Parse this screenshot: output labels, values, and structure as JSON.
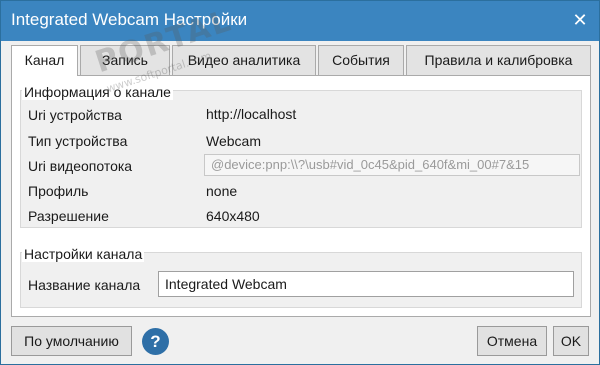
{
  "window": {
    "title": "Integrated Webcam Настройки",
    "close_icon": "close-icon"
  },
  "tabs": [
    {
      "label": "Канал",
      "active": true
    },
    {
      "label": "Запись",
      "active": false
    },
    {
      "label": "Видео аналитика",
      "active": false
    },
    {
      "label": "События",
      "active": false
    },
    {
      "label": "Правила и калибровка",
      "active": false
    }
  ],
  "channel_info": {
    "legend": "Информация о канале",
    "rows": [
      {
        "label": "Uri устройства",
        "value": "http://localhost"
      },
      {
        "label": "Тип устройства",
        "value": "Webcam"
      },
      {
        "label": "Uri видеопотока",
        "value": "@device:pnp:\\\\?\\usb#vid_0c45&pid_640f&mi_00#7&15"
      },
      {
        "label": "Профиль",
        "value": "none"
      },
      {
        "label": "Разрешение",
        "value": "640x480"
      }
    ]
  },
  "channel_settings": {
    "legend": "Настройки канала",
    "name_label": "Название канала",
    "name_value": "Integrated Webcam"
  },
  "footer": {
    "default_label": "По умолчанию",
    "help_icon": "help-icon",
    "help_glyph": "?",
    "cancel_label": "Отмена",
    "ok_label": "OK"
  },
  "watermark": {
    "text": "PORTAL",
    "subtext": "www.softportal.com"
  },
  "colors": {
    "titlebar": "#3b85c0",
    "help": "#2e6fa7"
  }
}
